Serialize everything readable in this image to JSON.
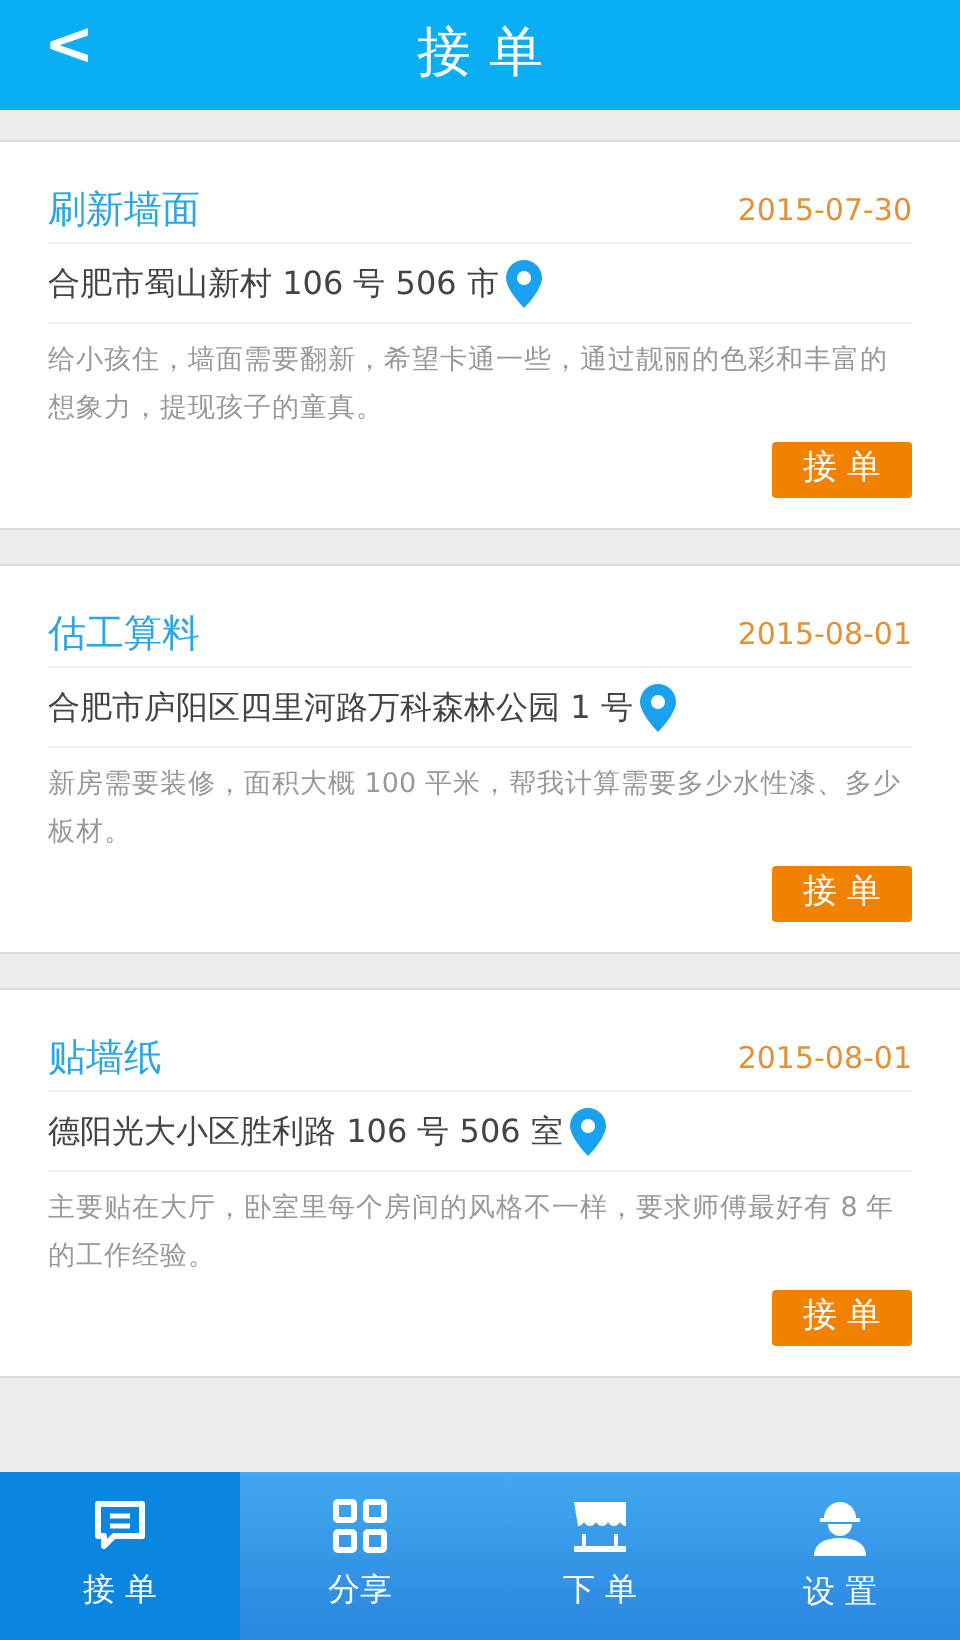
{
  "header": {
    "back": "<",
    "title": "接 单"
  },
  "orders": [
    {
      "title": "刷新墙面",
      "date": "2015-07-30",
      "address": "合肥市蜀山新村 106 号 506 市",
      "description": "给小孩住，墙面需要翻新，希望卡通一些，通过靓丽的色彩和丰富的想象力，提现孩子的童真。",
      "button": "接 单"
    },
    {
      "title": "估工算料",
      "date": "2015-08-01",
      "address": "合肥市庐阳区四里河路万科森林公园 1 号",
      "description": "新房需要装修，面积大概 100 平米，帮我计算需要多少水性漆、多少板材。",
      "button": "接 单"
    },
    {
      "title": "贴墙纸",
      "date": "2015-08-01",
      "address": "德阳光大小区胜利路 106 号 506 室",
      "description": "主要贴在大厅，卧室里每个房间的风格不一样，要求师傅最好有 8 年的工作经验。",
      "button": "接 单"
    }
  ],
  "tabs": [
    {
      "kind": "chat",
      "label": "接 单",
      "selected": true
    },
    {
      "kind": "grid",
      "label": "分享",
      "selected": false
    },
    {
      "kind": "shop",
      "label": "下 单",
      "selected": false
    },
    {
      "kind": "worker",
      "label": "设 置",
      "selected": false
    }
  ]
}
